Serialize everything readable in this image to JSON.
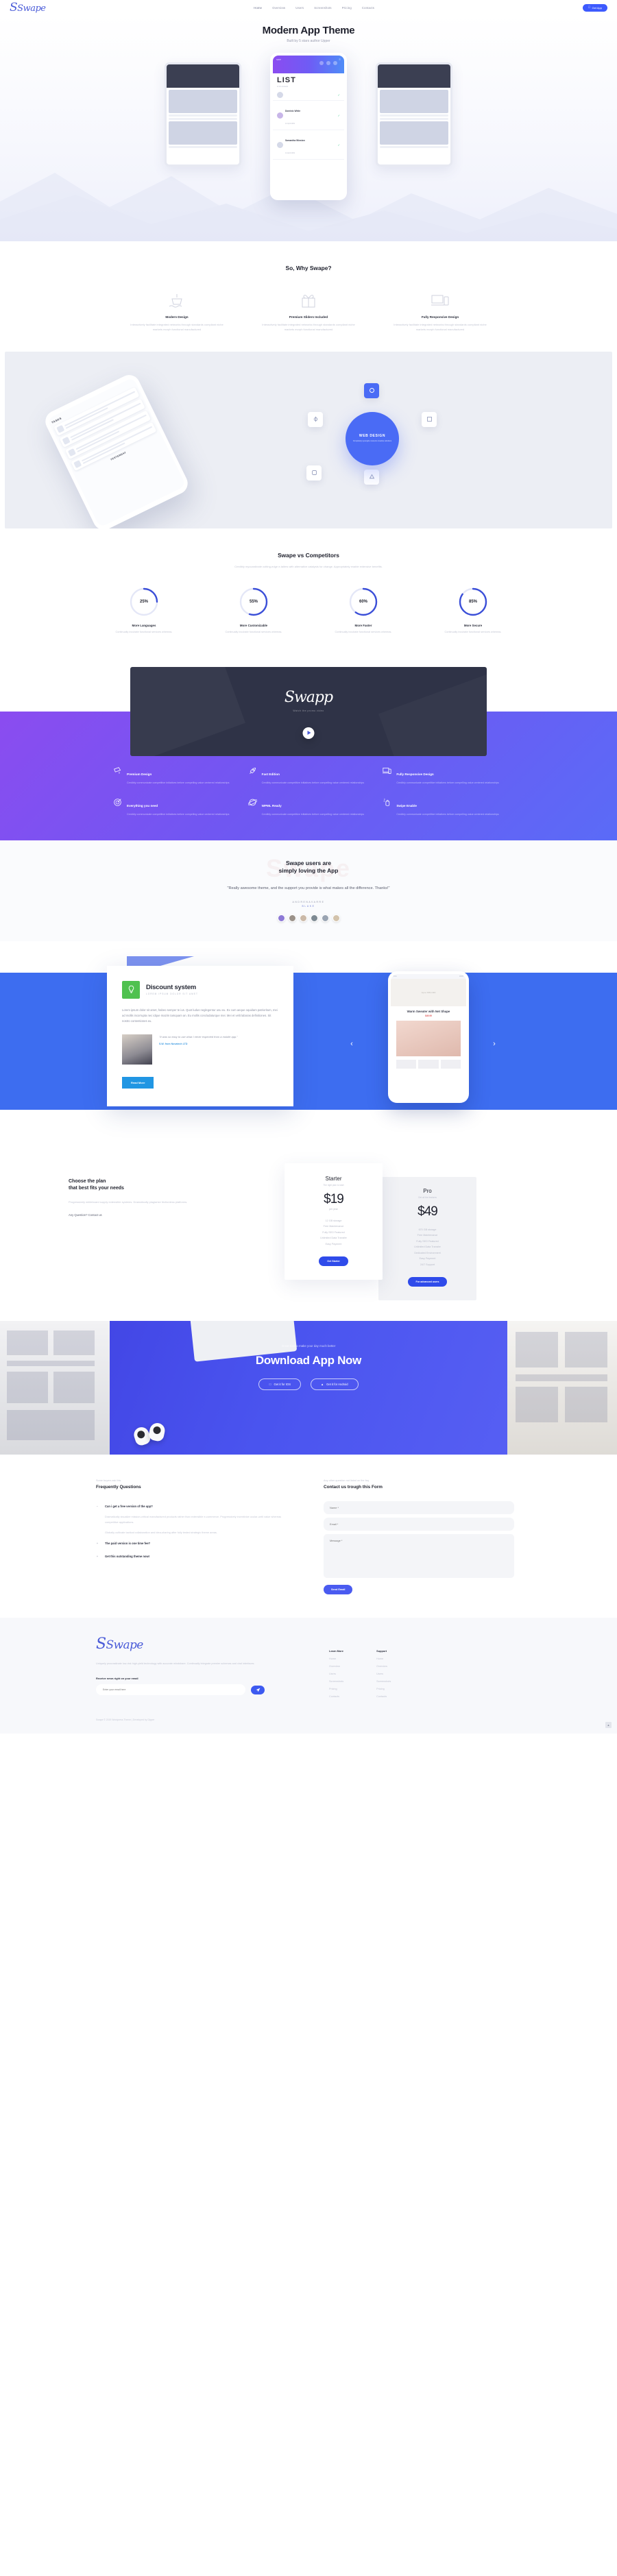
{
  "header": {
    "logo": "Swape",
    "nav": [
      {
        "label": "Home",
        "active": true
      },
      {
        "label": "Overview",
        "active": false
      },
      {
        "label": "Users",
        "active": false
      },
      {
        "label": "Screenshots",
        "active": false
      },
      {
        "label": "Pricing",
        "active": false
      },
      {
        "label": "Contacts",
        "active": false
      }
    ],
    "cta": "Get App"
  },
  "hero": {
    "title": "Modern App Theme",
    "subtitle": "Built by 5 stars author Upper",
    "phone": {
      "list_title": "LIST",
      "list_sub": "of 24 contacts",
      "items": [
        {
          "name": "Dominic White",
          "date": "12 April 2019"
        },
        {
          "name": "Samantha Winston",
          "date": "14 April 2019"
        }
      ]
    }
  },
  "why": {
    "title": "So, Why Swape?",
    "columns": [
      {
        "icon": "boat-icon",
        "heading": "Modern Design",
        "text": "Interactively facilitate integrated networks through standards compliant niche markets morph functional manufactured"
      },
      {
        "icon": "gift-icon",
        "heading": "Premium Sliders Included",
        "text": "Interactively facilitate integrated networks through standards compliant niche markets morph functional manufactured"
      },
      {
        "icon": "devices-icon",
        "heading": "Fully Responsive Design",
        "text": "Interactively facilitate integrated networks through standards compliant niche markets morph functional manufactured"
      }
    ]
  },
  "webdesign": {
    "circle_title": "WEB DESIGN",
    "circle_sub": "Completely synergize resource creative solutions",
    "phone_header": "TASKS",
    "phone_footer": "YESTERDAY"
  },
  "competitors": {
    "title": "Swape vs Competitors",
    "subtitle": "Credibly myocardinate cutting-edge e-tailers with alternative catalysts for change. Appropriately enable extensive benefits.",
    "chart_data": {
      "type": "bar",
      "categories": [
        "More Languages",
        "More Customizable",
        "More Faster",
        "More Secure"
      ],
      "values": [
        25,
        55,
        60,
        85
      ],
      "title": "Swape vs Competitors",
      "xlabel": "",
      "ylabel": "Percent",
      "ylim": [
        0,
        100
      ],
      "unit": "%",
      "accent": "#3b4fd8",
      "track": "#e4e7f7"
    },
    "items": [
      {
        "value": "25%",
        "pct": 25,
        "heading": "More Languages",
        "text": "Continually incubate functional services whereas."
      },
      {
        "value": "55%",
        "pct": 55,
        "heading": "More Customizable",
        "text": "Continually incubate functional services whereas."
      },
      {
        "value": "60%",
        "pct": 60,
        "heading": "More Faster",
        "text": "Continually incubate functional services whereas."
      },
      {
        "value": "85%",
        "pct": 85,
        "heading": "More Secure",
        "text": "Continually incubate functional services whereas."
      }
    ]
  },
  "video": {
    "logo": "Swapp",
    "tagline": "Watch the promo video"
  },
  "features": [
    {
      "icon": "camera-icon",
      "heading": "Premium Design",
      "text": "Credibly communicate competitive initiatives before compelling value centered relationships"
    },
    {
      "icon": "rocket-icon",
      "heading": "Fast Edition",
      "text": "Credibly communicate competitive initiatives before compelling value centered relationships"
    },
    {
      "icon": "responsive-icon",
      "heading": "Fully Responsive Design",
      "text": "Credibly communicate competitive initiatives before compelling value centered relationships"
    },
    {
      "icon": "target-icon",
      "heading": "Everything you need",
      "text": "Credibly communicate competitive initiatives before compelling value centered relationships"
    },
    {
      "icon": "globe-icon",
      "heading": "WPML Ready",
      "text": "Credibly communicate competitive initiatives before compelling value centered relationships"
    },
    {
      "icon": "swipe-hand-icon",
      "heading": "Swipe Enable",
      "text": "Credibly communicate competitive initiatives before compelling value centered relationships"
    }
  ],
  "testimonials": {
    "ghost_text": "Swape",
    "heading_line1": "Swape users are",
    "heading_line2": "simply loving the App",
    "quote": "\"Really awesome theme, and the support you provide is what makes all the difference. Thanks!\"",
    "author": "ANDRENAVARRE",
    "author_sub": "BLAKE",
    "avatars": [
      "#8d79d6",
      "#9a9189",
      "#cbb9a8",
      "#7e8a93",
      "#9aa4b2",
      "#d3c3ac"
    ]
  },
  "discount": {
    "badge_icon": "lightbulb-icon",
    "title": "Discount system",
    "kicker": "LOREM IPSUM DOLOR SIT AMET",
    "body": "Lorem ipsum dolor sit amet, habeo semper te ius. Quot ludus neglegentur usu eu. Ex cum aeque oquidam patrioritum, mei ad mollis incorrupta nec idque mazim tamquam an. Eu mollis concludaturque mei. Mei et velit laboras definitiones. Sit nostro contentiones eu.",
    "quote": "\"It was so easy to use what I never expected from a mobile app.\"",
    "quote_author": "S.W. from Novatech LTD",
    "button": "Read More",
    "phone": {
      "status_left": "9:41",
      "status_right": "100%",
      "banner": "Up to 70% OFF",
      "title": "Warm Sweater with Net Shape",
      "price": "$49.99",
      "shop": "SHOP NOW"
    },
    "prev": "‹",
    "next": "›"
  },
  "pricing": {
    "heading_line1": "Choose the plan",
    "heading_line2": "that best fits your needs",
    "text": "Progressively whiteboard supply extensible systems. Dramatically plagiarize frictionless platforms.",
    "contact_link": "Any Question? Contact us",
    "plans": [
      {
        "name": "Starter",
        "kicker": "The right plan to start",
        "price": "$19",
        "per": "per year",
        "features": [
          "12 GB storage",
          "Free Maintenance",
          "Fully SEO Featured",
          "Unlimited Data Transfer",
          "Easy Payment"
        ],
        "button": "Get Starter"
      },
      {
        "name": "Pro",
        "kicker": "Get all the features",
        "price": "$49",
        "per": "",
        "features": [
          "670 GB storage",
          "Free Maintenance",
          "Fully SEO Featured",
          "Unlimited Data Transfer",
          "Dedicated Environment",
          "Easy Payment",
          "24/7 Support"
        ],
        "button": "For advanced users"
      }
    ]
  },
  "download": {
    "kicker": "Great tool to make your day much better",
    "title": "Download App Now",
    "btn_ios": "Get it for IOS",
    "btn_android": "Get it for Android"
  },
  "faq": {
    "kicker": "Some buyers ask this",
    "title": "Frequently Questions",
    "items": [
      {
        "sign": "−",
        "question": "Can i get a free version of the app?",
        "answer1": "Dramatically visualize mission-critical manufactured products rather than extensible e-commerce. Progressively incentivize ocular-until value whereas competitive applications.",
        "answer2": "Globally cultivate tactical collaboration and idea-sharing after fully tested strategic theme areas.",
        "open": true
      },
      {
        "sign": "+",
        "question": "The paid version is one time fee?",
        "open": false
      },
      {
        "sign": "+",
        "question": "Get this outstanding theme now!",
        "open": false
      }
    ]
  },
  "contact": {
    "kicker": "Any other question not listed on the faq",
    "title": "Contact us trough this Form",
    "name_placeholder": "Name *",
    "email_placeholder": "Email *",
    "message_placeholder": "Message *",
    "submit": "Send Email"
  },
  "footer": {
    "logo": "Swape",
    "text": "Uniquely procrastinate low-risk high-yield technology with accurate mindshare. Continually integrate premier schemas and viral interfaces.",
    "newsletter_label": "Receive news right on your email",
    "newsletter_placeholder": "Enter your email here",
    "send_icon": "paper-plane-icon",
    "columns": [
      {
        "title": "Learn More",
        "links": [
          "Home",
          "Overview",
          "Users",
          "Screenshots",
          "Pricing",
          "Contacts"
        ]
      },
      {
        "title": "Support",
        "links": [
          "Home",
          "Overview",
          "Users",
          "Screenshots",
          "Pricing",
          "Contacts"
        ]
      }
    ],
    "copyright": "Swape © 2019 Wordpress Theme | Developed by Dipper",
    "scroll_top": "▲"
  }
}
